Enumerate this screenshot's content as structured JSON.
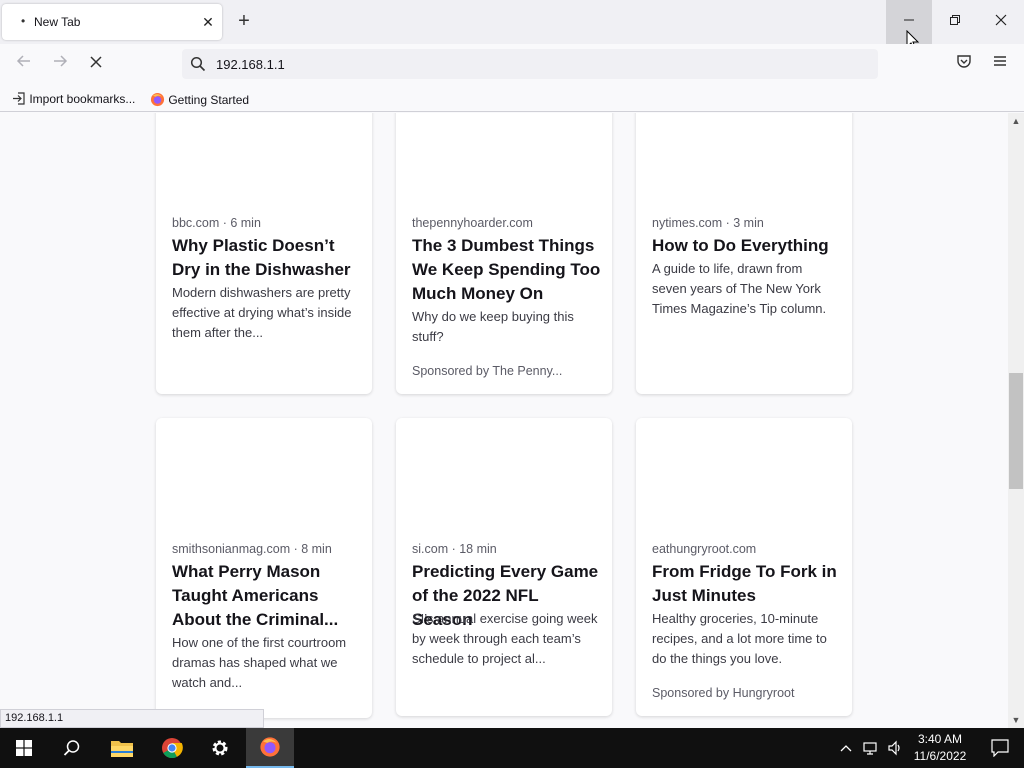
{
  "browser": {
    "tab_title": "New Tab",
    "url": "192.168.1.1",
    "status_url": "192.168.1.1",
    "bookmarks": [
      "Import bookmarks...",
      "Getting Started"
    ]
  },
  "cards": [
    {
      "source": "bbc.com · 6 min",
      "title": "Why Plastic Doesn’t Dry in the Dishwasher",
      "desc": "Modern dishwashers are pretty effective at drying what’s inside them after the...",
      "sponsor": ""
    },
    {
      "source": "thepennyhoarder.com",
      "title": "The 3 Dumbest Things We Keep Spending Too Much Money On",
      "desc": "Why do we keep buying this stuff?",
      "sponsor": "Sponsored by The Penny..."
    },
    {
      "source": "nytimes.com · 3 min",
      "title": "How to Do Everything",
      "desc": "A guide to life, drawn from seven years of The New York Times Magazine’s Tip column.",
      "sponsor": ""
    },
    {
      "source": "smithsonianmag.com · 8 min",
      "title": "What Perry Mason Taught Americans About the Criminal...",
      "desc": "How one of the first courtroom dramas has shaped what we watch and...",
      "sponsor": ""
    },
    {
      "source": "si.com · 18 min",
      "title": "Predicting Every Game of the 2022 NFL Season",
      "desc": "SI’s annual exercise going week by week through each team’s schedule to project al...",
      "sponsor": ""
    },
    {
      "source": "eathungryroot.com",
      "title": "From Fridge To Fork in Just Minutes",
      "desc": "Healthy groceries, 10-minute recipes, and a lot more time to do the things you love.",
      "sponsor": "Sponsored by Hungryroot"
    }
  ],
  "taskbar": {
    "time": "3:40 AM",
    "date": "11/6/2022"
  },
  "icons": {
    "tab_loading": "dot-icon",
    "search": "search-icon",
    "firefox": "firefox-icon"
  }
}
